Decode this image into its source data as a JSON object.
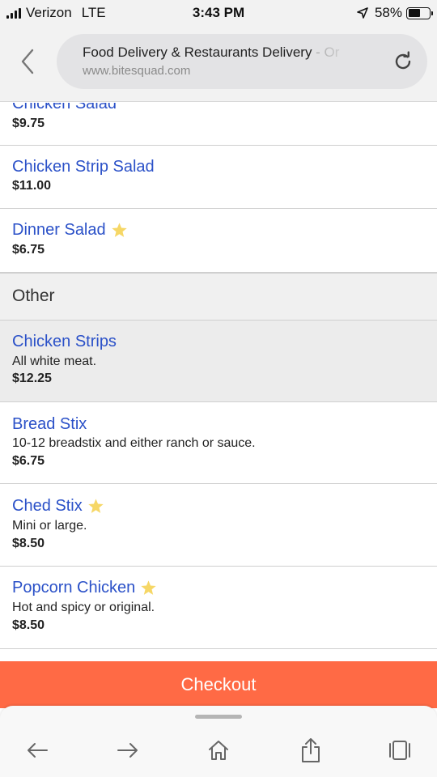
{
  "status_bar": {
    "carrier": "Verizon",
    "network": "LTE",
    "time": "3:43 PM",
    "battery": "58%",
    "battery_level": 0.58
  },
  "address_bar": {
    "page_title": "Food Delivery & Restaurants Delivery",
    "page_title_suffix": " - Or",
    "domain": "www.bitesquad.com"
  },
  "menu": {
    "items_top": [
      {
        "name": "Chicken Salad",
        "price": "$9.75",
        "starred": false
      },
      {
        "name": "Chicken Strip Salad",
        "price": "$11.00",
        "starred": false
      },
      {
        "name": "Dinner Salad",
        "price": "$6.75",
        "starred": true
      }
    ],
    "section": {
      "title": "Other"
    },
    "items_other": [
      {
        "name": "Chicken Strips",
        "description": "All white meat.",
        "price": "$12.25",
        "starred": false
      },
      {
        "name": "Bread Stix",
        "description": "10-12 breadstix and either ranch or sauce.",
        "price": "$6.75",
        "starred": false
      },
      {
        "name": "Ched Stix",
        "description": "Mini or large.",
        "price": "$8.50",
        "starred": true
      },
      {
        "name": "Popcorn Chicken",
        "description": "Hot and spicy or original.",
        "price": "$8.50",
        "starred": true
      }
    ]
  },
  "checkout": {
    "label": "Checkout"
  },
  "toolbar": {
    "icons": [
      "back-arrow-icon",
      "forward-arrow-icon",
      "home-icon",
      "share-icon",
      "tabs-icon"
    ]
  },
  "colors": {
    "link": "#2b51c8",
    "checkout": "#ff6a45",
    "star": "#f6d766",
    "highlight_row": "#ececec"
  }
}
